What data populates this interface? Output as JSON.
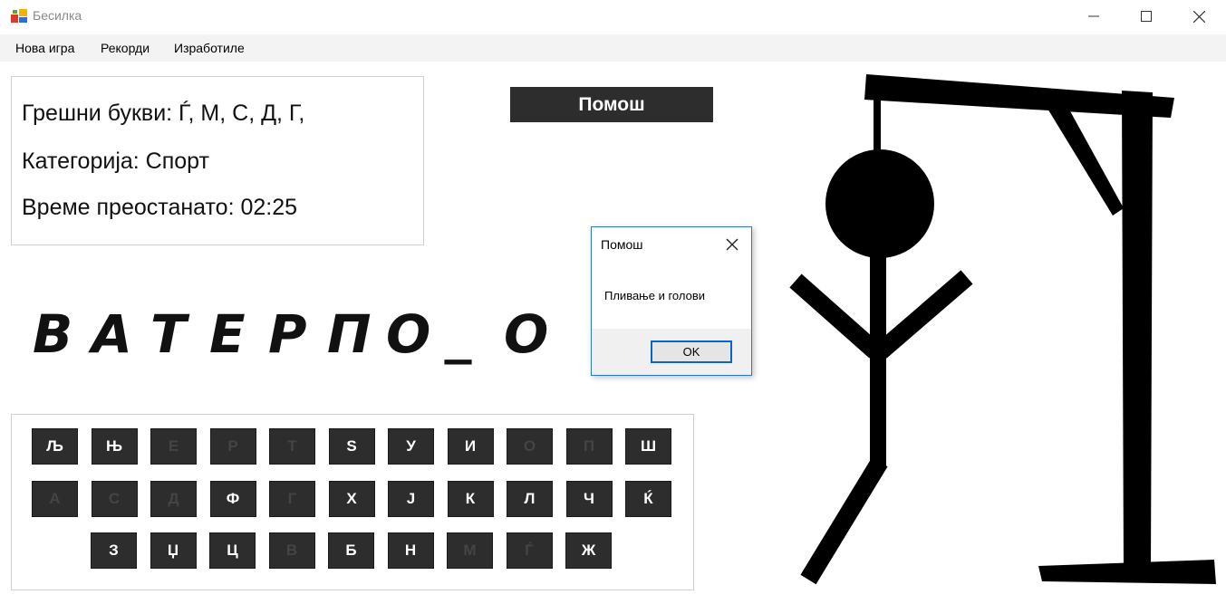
{
  "window": {
    "title": "Бесилка"
  },
  "menu": {
    "items": [
      "Нова игра",
      "Рекорди",
      "Изработиле"
    ]
  },
  "info": {
    "wrong_letters": "Грешни букви:  Ѓ, М, С, Д, Г,",
    "category": "Категорија: Спорт",
    "time_left": "Време преостанато: 02:25"
  },
  "help_button": "Помош",
  "word": {
    "letters": [
      "В",
      "А",
      "Т",
      "Е",
      "Р",
      "П",
      "О",
      "_",
      "О"
    ]
  },
  "keyboard": {
    "rows": [
      [
        {
          "l": "Љ",
          "used": false
        },
        {
          "l": "Њ",
          "used": false
        },
        {
          "l": "Е",
          "used": true
        },
        {
          "l": "Р",
          "used": true
        },
        {
          "l": "Т",
          "used": true
        },
        {
          "l": "S",
          "used": false
        },
        {
          "l": "У",
          "used": false
        },
        {
          "l": "И",
          "used": false
        },
        {
          "l": "О",
          "used": true
        },
        {
          "l": "П",
          "used": true
        },
        {
          "l": "Ш",
          "used": false
        }
      ],
      [
        {
          "l": "А",
          "used": true
        },
        {
          "l": "С",
          "used": true
        },
        {
          "l": "Д",
          "used": true
        },
        {
          "l": "Ф",
          "used": false
        },
        {
          "l": "Г",
          "used": true
        },
        {
          "l": "Х",
          "used": false
        },
        {
          "l": "Ј",
          "used": false
        },
        {
          "l": "К",
          "used": false
        },
        {
          "l": "Л",
          "used": false
        },
        {
          "l": "Ч",
          "used": false
        },
        {
          "l": "Ќ",
          "used": false
        }
      ],
      [
        {
          "l": "З",
          "used": false
        },
        {
          "l": "Џ",
          "used": false
        },
        {
          "l": "Ц",
          "used": false
        },
        {
          "l": "В",
          "used": true
        },
        {
          "l": "Б",
          "used": false
        },
        {
          "l": "Н",
          "used": false
        },
        {
          "l": "М",
          "used": true
        },
        {
          "l": "Ѓ",
          "used": true
        },
        {
          "l": "Ж",
          "used": false
        }
      ]
    ]
  },
  "dialog": {
    "title": "Помош",
    "message": "Пливање и голови",
    "ok_label": "OK"
  },
  "icons": {
    "app": "app-icon",
    "minimize": "minimize-icon",
    "maximize": "maximize-icon",
    "close": "close-icon"
  }
}
